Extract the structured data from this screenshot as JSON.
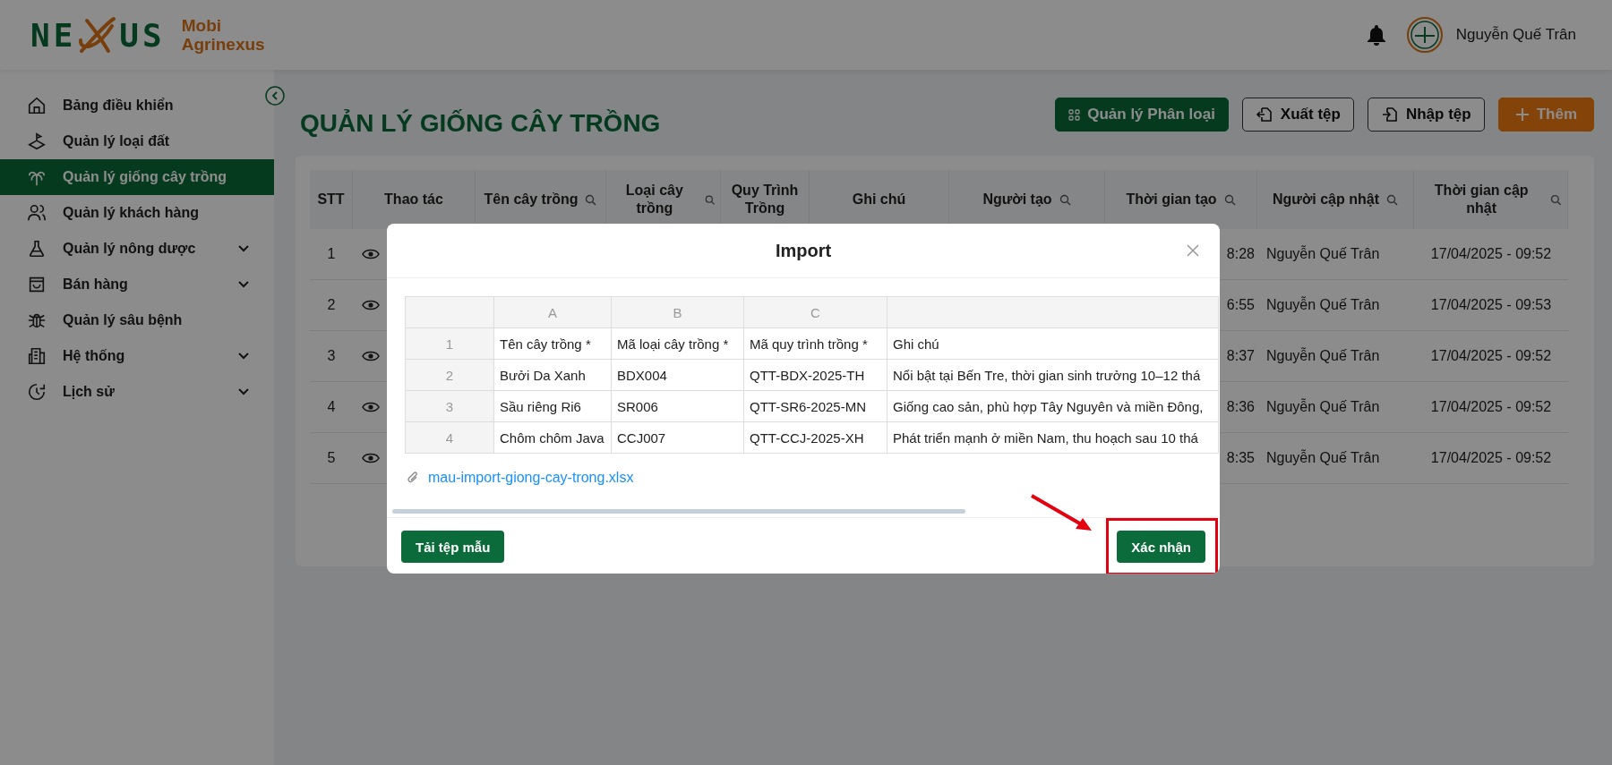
{
  "header": {
    "logo_left": "NE",
    "logo_right": "US",
    "brand_line1": "Mobi",
    "brand_line2": "Agrinexus",
    "user_name": "Nguyễn Quế Trân"
  },
  "sidebar": {
    "items": [
      {
        "label": "Bảng điều khiển",
        "selected": false,
        "expandable": false
      },
      {
        "label": "Quản lý loại đất",
        "selected": false,
        "expandable": false
      },
      {
        "label": "Quản lý giống cây trồng",
        "selected": true,
        "expandable": false
      },
      {
        "label": "Quản lý khách hàng",
        "selected": false,
        "expandable": false
      },
      {
        "label": "Quản lý nông dược",
        "selected": false,
        "expandable": true
      },
      {
        "label": "Bán hàng",
        "selected": false,
        "expandable": true
      },
      {
        "label": "Quản lý sâu bệnh",
        "selected": false,
        "expandable": false
      },
      {
        "label": "Hệ thống",
        "selected": false,
        "expandable": true
      },
      {
        "label": "Lịch sử",
        "selected": false,
        "expandable": true
      }
    ]
  },
  "page": {
    "title": "QUẢN LÝ GIỐNG CÂY TRỒNG",
    "buttons": [
      {
        "label": "Quản lý Phân loại",
        "kind": "primary"
      },
      {
        "label": "Xuất tệp",
        "kind": "export"
      },
      {
        "label": "Nhập tệp",
        "kind": "import"
      },
      {
        "label": "Thêm",
        "kind": "add"
      }
    ]
  },
  "table": {
    "columns": [
      {
        "label": "STT",
        "searchable": false
      },
      {
        "label": "Thao tác",
        "searchable": false
      },
      {
        "label": "Tên cây trồng",
        "searchable": true
      },
      {
        "label": "Loại cây trồng",
        "searchable": true
      },
      {
        "label": "Quy Trình Trồng",
        "searchable": false
      },
      {
        "label": "Ghi chú",
        "searchable": false
      },
      {
        "label": "Người tạo",
        "searchable": true
      },
      {
        "label": "Thời gian tạo",
        "searchable": true
      },
      {
        "label": "Người cập nhật",
        "searchable": true
      },
      {
        "label": "Thời gian cập nhật",
        "searchable": true
      }
    ],
    "rows": [
      {
        "stt": "1",
        "created_time": "8:28",
        "updated_by": "Nguyễn Quế Trân",
        "updated_time": "17/04/2025 - 09:52"
      },
      {
        "stt": "2",
        "created_time": "6:55",
        "updated_by": "Nguyễn Quế Trân",
        "updated_time": "17/04/2025 - 09:53"
      },
      {
        "stt": "3",
        "created_time": "8:37",
        "updated_by": "Nguyễn Quế Trân",
        "updated_time": "17/04/2025 - 09:52"
      },
      {
        "stt": "4",
        "created_time": "8:36",
        "updated_by": "Nguyễn Quế Trân",
        "updated_time": "17/04/2025 - 09:52"
      },
      {
        "stt": "5",
        "created_time": "8:35",
        "updated_by": "Nguyễn Quế Trân",
        "updated_time": "17/04/2025 - 09:52"
      }
    ]
  },
  "modal": {
    "title": "Import",
    "sheet": {
      "columns": [
        "A",
        "B",
        "C",
        ""
      ],
      "rows": [
        {
          "num": "1",
          "cells": [
            "Tên cây trồng *",
            "Mã loại cây trồng *",
            "Mã quy trình trồng *",
            "Ghi chú"
          ]
        },
        {
          "num": "2",
          "cells": [
            "Bưởi Da Xanh",
            "BDX004",
            "QTT-BDX-2025-TH",
            "Nổi bật tại Bến Tre, thời gian sinh trưởng 10–12 thá"
          ]
        },
        {
          "num": "3",
          "cells": [
            "Sầu riêng Ri6",
            "SR006",
            "QTT-SR6-2025-MN",
            "Giống cao sản, phù hợp Tây Nguyên và miền Đông,"
          ]
        },
        {
          "num": "4",
          "cells": [
            "Chôm chôm Java",
            "CCJ007",
            "QTT-CCJ-2025-XH",
            "Phát triển mạnh ở miền Nam, thu hoạch sau 10 thá"
          ]
        }
      ]
    },
    "file_name": "mau-import-giong-cay-trong.xlsx",
    "download_button": "Tải tệp mẫu",
    "confirm_button": "Xác nhận"
  }
}
